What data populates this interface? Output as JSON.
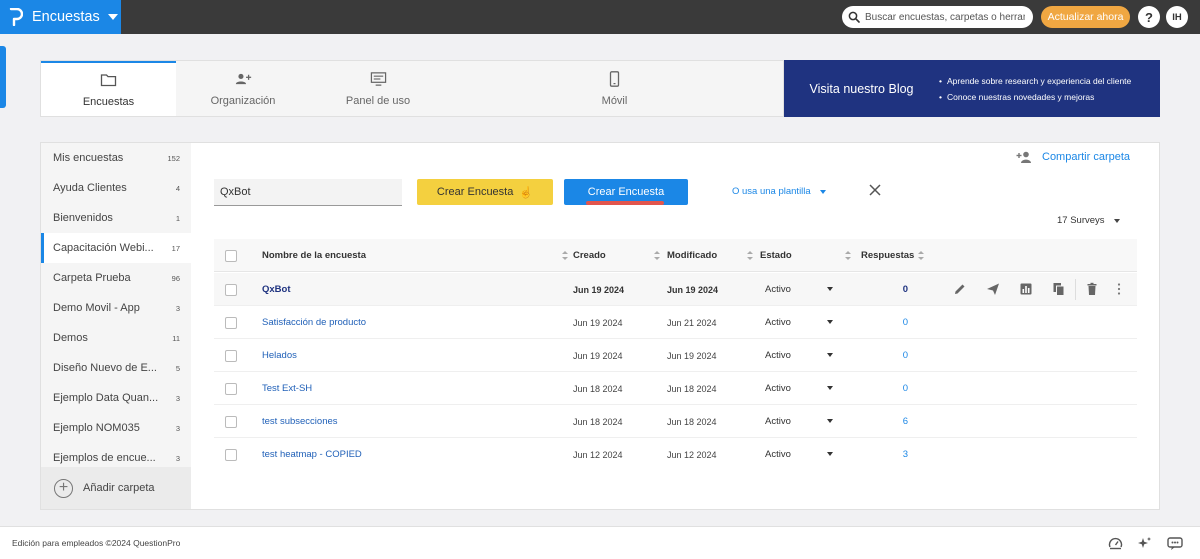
{
  "app": {
    "title": "Encuestas",
    "search_placeholder": "Buscar encuestas, carpetas o herrami",
    "upgrade_label": "Actualizar ahora",
    "help_label": "?",
    "user_initials": "IH"
  },
  "tabs": [
    {
      "label": "Encuestas",
      "icon": "folder-icon"
    },
    {
      "label": "Organización",
      "icon": "add-users-icon"
    },
    {
      "label": "Panel de uso",
      "icon": "usage-panel-icon"
    },
    {
      "label": "Móvil",
      "icon": "mobile-icon"
    }
  ],
  "blog": {
    "title": "Visita nuestro Blog",
    "bullets": [
      "Aprende sobre research y experiencia del cliente",
      "Conoce nuestras novedades y mejoras"
    ]
  },
  "sidebar": {
    "folders": [
      {
        "label": "Mis encuestas",
        "count": "152"
      },
      {
        "label": "Ayuda Clientes",
        "count": "4"
      },
      {
        "label": "Bienvenidos",
        "count": "1"
      },
      {
        "label": "Capacitación Webi...",
        "count": "17"
      },
      {
        "label": "Carpeta Prueba",
        "count": "96"
      },
      {
        "label": "Demo Movil - App",
        "count": "3"
      },
      {
        "label": "Demos",
        "count": "11"
      },
      {
        "label": "Diseño Nuevo de E...",
        "count": "5"
      },
      {
        "label": "Ejemplo Data Quan...",
        "count": "3"
      },
      {
        "label": "Ejemplo NOM035",
        "count": "3"
      },
      {
        "label": "Ejemplos de encue...",
        "count": "3"
      }
    ],
    "add_folder_label": "Añadir carpeta"
  },
  "toolbar": {
    "share_label": "Compartir carpeta",
    "survey_name_value": "QxBot",
    "create_survey_label": "Crear Encuesta",
    "create_survey_ai_icon": "hand-pointer-icon",
    "template_label": "O usa una plantilla",
    "survey_count_label": "17 Surveys"
  },
  "table": {
    "headers": {
      "name": "Nombre de la encuesta",
      "created": "Creado",
      "modified": "Modificado",
      "status": "Estado",
      "responses": "Respuestas"
    },
    "rows": [
      {
        "name": "QxBot",
        "created": "Jun 19 2024",
        "modified": "Jun 19 2024",
        "status": "Activo",
        "responses": "0"
      },
      {
        "name": "Satisfacción de producto",
        "created": "Jun 19 2024",
        "modified": "Jun 21 2024",
        "status": "Activo",
        "responses": "0"
      },
      {
        "name": "Helados",
        "created": "Jun 19 2024",
        "modified": "Jun 19 2024",
        "status": "Activo",
        "responses": "0"
      },
      {
        "name": "Test Ext-SH",
        "created": "Jun 18 2024",
        "modified": "Jun 18 2024",
        "status": "Activo",
        "responses": "0"
      },
      {
        "name": "test subsecciones",
        "created": "Jun 18 2024",
        "modified": "Jun 18 2024",
        "status": "Activo",
        "responses": "6"
      },
      {
        "name": "test heatmap - COPIED",
        "created": "Jun 12 2024",
        "modified": "Jun 12 2024",
        "status": "Activo",
        "responses": "3"
      }
    ],
    "row_actions": [
      "edit-icon",
      "send-icon",
      "report-icon",
      "copy-icon",
      "delete-icon",
      "more-icon"
    ]
  },
  "footer": {
    "copyright": "Edición para empleados ©2024 QuestionPro"
  },
  "colors": {
    "accent": "#1b87e6",
    "topbar": "#3a3a3a",
    "upgrade": "#f0a742",
    "blog": "#1f3380",
    "create_button": "#f4d03f"
  }
}
